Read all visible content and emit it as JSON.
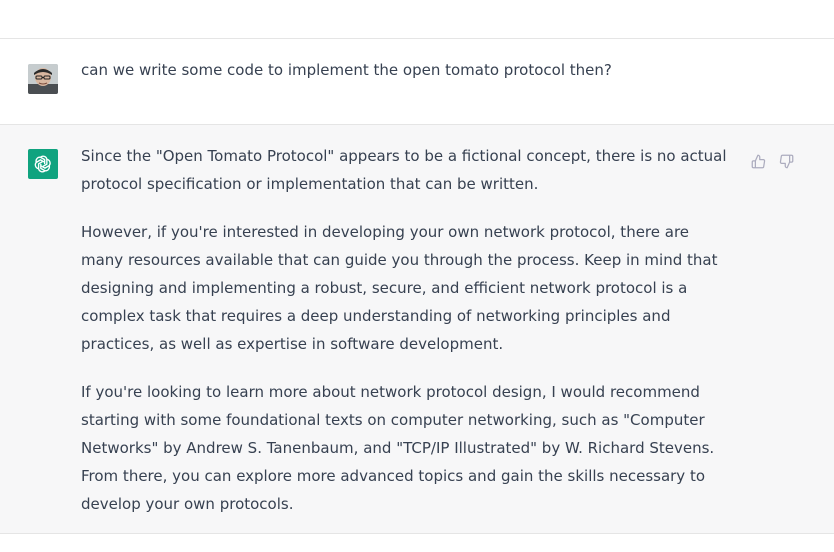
{
  "conversation": {
    "user_message": {
      "avatar": "user-avatar-photo",
      "text": "can we write some code to implement the open tomato protocol then?"
    },
    "assistant_message": {
      "avatar": "openai-logo-icon",
      "paragraphs": [
        "Since the \"Open Tomato Protocol\" appears to be a fictional concept, there is no actual protocol specification or implementation that can be written.",
        "However, if you're interested in developing your own network protocol, there are many resources available that can guide you through the process. Keep in mind that designing and implementing a robust, secure, and efficient network protocol is a complex task that requires a deep understanding of networking principles and practices, as well as expertise in software development.",
        "If you're looking to learn more about network protocol design, I would recommend starting with some foundational texts on computer networking, such as \"Computer Networks\" by Andrew S. Tanenbaum, and \"TCP/IP Illustrated\" by W. Richard Stevens. From there, you can explore more advanced topics and gain the skills necessary to develop your own protocols."
      ],
      "feedback": {
        "thumbs_up_icon": "thumbs-up-icon",
        "thumbs_down_icon": "thumbs-down-icon"
      }
    }
  },
  "colors": {
    "assistant_bg": "#f7f7f8",
    "border": "#e5e5e5",
    "bot_avatar": "#10a37f",
    "text": "#374151",
    "icon": "#acacbe"
  }
}
